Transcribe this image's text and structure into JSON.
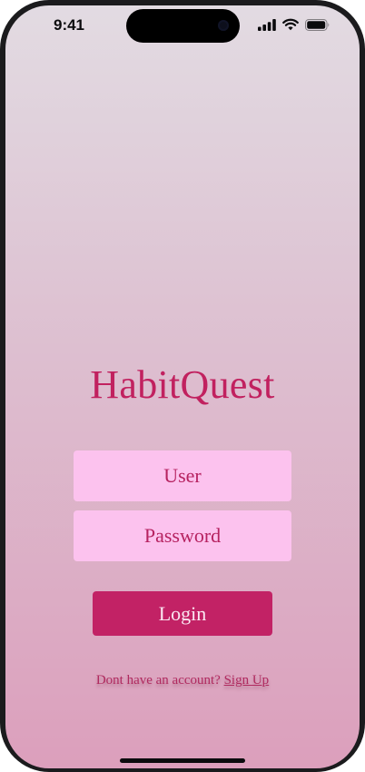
{
  "status_bar": {
    "time": "9:41"
  },
  "app": {
    "title": "HabitQuest"
  },
  "form": {
    "user_placeholder": "User",
    "password_placeholder": "Password",
    "login_label": "Login"
  },
  "signup": {
    "prompt": "Dont have an account?",
    "link_label": "Sign Up"
  },
  "colors": {
    "brand": "#c1215f",
    "field_background": "#fcc2ee",
    "button_background": "#c22265",
    "background_top": "#e2dbe2",
    "background_bottom": "#dc9fbc"
  },
  "icons": {
    "signal": "cellular-signal-icon",
    "wifi": "wifi-icon",
    "battery": "battery-icon"
  }
}
